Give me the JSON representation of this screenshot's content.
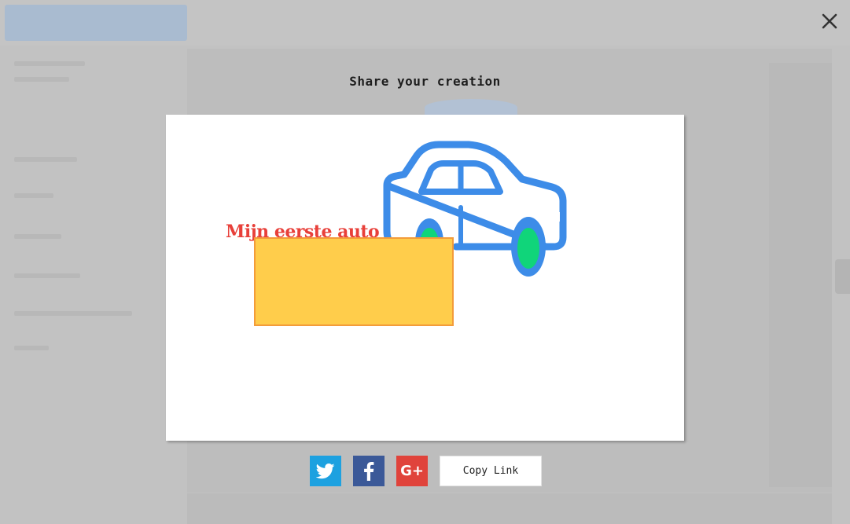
{
  "modal": {
    "title": "Share your creation",
    "close_icon": "close-icon"
  },
  "preview": {
    "text": "Mijn eerste auto",
    "colors": {
      "text": "#e8403a",
      "car_body": "#3d8ce8",
      "wheel": "#10d57a",
      "rect_fill": "#ffcd4b",
      "rect_border": "#f39c3a"
    }
  },
  "share": {
    "twitter_icon": "twitter-icon",
    "facebook_icon": "facebook-icon",
    "google_plus_label": "G+",
    "copy_link_label": "Copy Link",
    "colors": {
      "twitter": "#1da1e0",
      "facebook": "#3b5998",
      "google_plus": "#e0433b"
    }
  }
}
